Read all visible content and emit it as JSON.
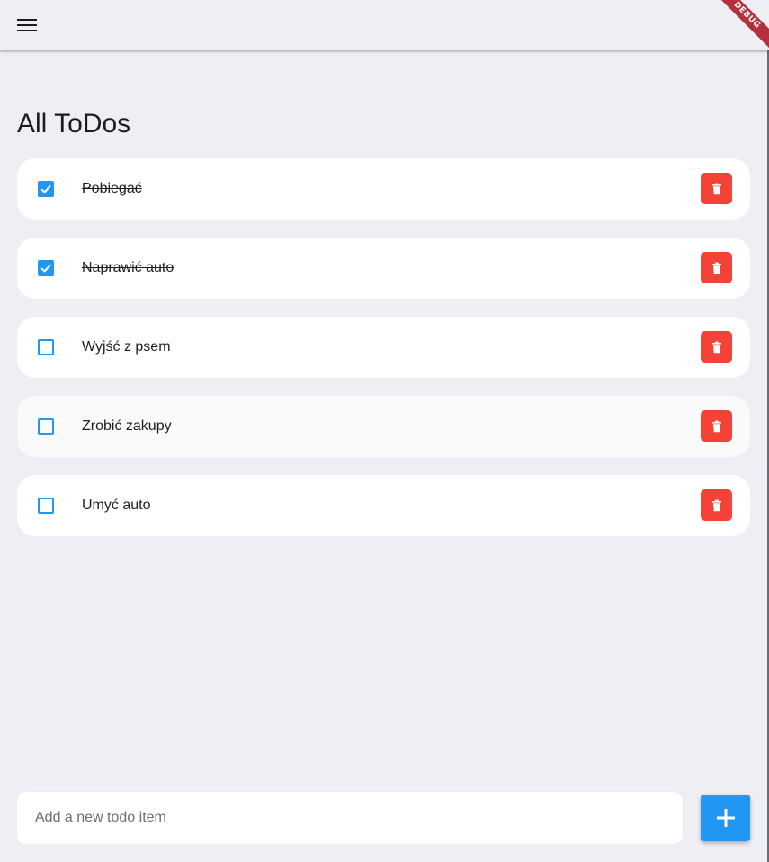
{
  "app": {
    "debug_banner": "DEBUG",
    "icons": {
      "menu": "menu-icon",
      "delete": "trash-icon",
      "add": "plus-icon",
      "check": "check-icon"
    },
    "colors": {
      "accent": "#2196f3",
      "delete": "#f44336",
      "background": "#eeeff5",
      "debug": "#b2313b"
    }
  },
  "main": {
    "title": "All ToDos",
    "todos": [
      {
        "text": "Pobiegać",
        "done": true
      },
      {
        "text": "Naprawić auto",
        "done": true
      },
      {
        "text": "Wyjść z psem",
        "done": false
      },
      {
        "text": "Zrobić zakupy",
        "done": false
      },
      {
        "text": "Umyć auto",
        "done": false
      }
    ]
  },
  "footer": {
    "input_placeholder": "Add a new todo item",
    "input_value": ""
  }
}
